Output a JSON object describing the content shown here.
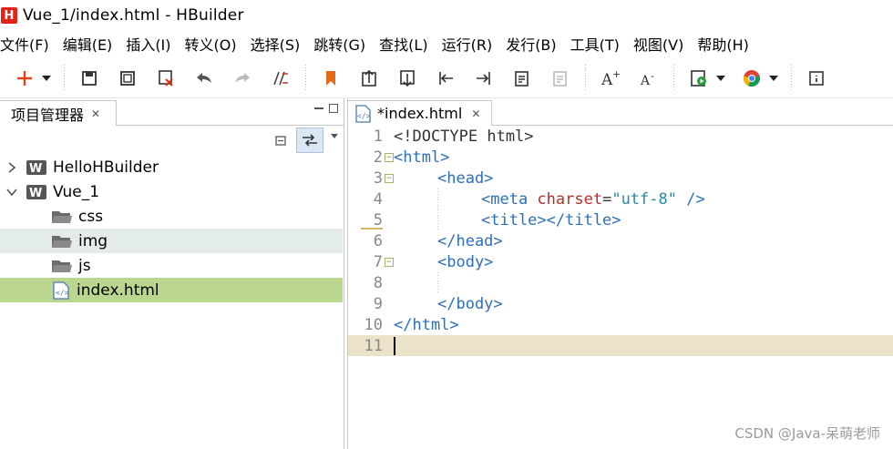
{
  "window": {
    "logo_letter": "H",
    "title": "Vue_1/index.html  -  HBuilder"
  },
  "menu": [
    "文件(F)",
    "编辑(E)",
    "插入(I)",
    "转义(O)",
    "选择(S)",
    "跳转(G)",
    "查找(L)",
    "运行(R)",
    "发行(B)",
    "工具(T)",
    "视图(V)",
    "帮助(H)"
  ],
  "toolbar_icons": [
    "new-icon",
    "save-icon",
    "save-all-icon",
    "close-save-icon",
    "undo-icon",
    "redo-icon",
    "format-icon",
    "bookmark-icon",
    "jump-start-icon",
    "jump-end-icon",
    "line-start-icon",
    "line-end-icon",
    "paste-icon",
    "paste-disabled-icon",
    "font-increase-icon",
    "font-decrease-icon",
    "run-icon",
    "chrome-icon",
    "help-icon"
  ],
  "project_panel": {
    "tab_label": "项目管理器",
    "tree": [
      {
        "label": "HelloHBuilder",
        "type": "project",
        "expanded": false
      },
      {
        "label": "Vue_1",
        "type": "project",
        "expanded": true
      },
      {
        "label": "css",
        "type": "folder"
      },
      {
        "label": "img",
        "type": "folder"
      },
      {
        "label": "js",
        "type": "folder"
      },
      {
        "label": "index.html",
        "type": "file"
      }
    ]
  },
  "editor": {
    "tab_label": "*index.html",
    "line_numbers": [
      "1",
      "2",
      "3",
      "4",
      "5",
      "6",
      "7",
      "8",
      "9",
      "10",
      "11"
    ],
    "code": {
      "l1": "<!DOCTYPE html>",
      "l2_tag": "<html>",
      "l3_tag": "<head>",
      "l4_open": "<meta ",
      "l4_attr": "charset",
      "l4_eq": "=",
      "l4_val": "\"utf-8\"",
      "l4_close": " />",
      "l5": "<title></title>",
      "l6": "</head>",
      "l7": "<body>",
      "l9": "</body>",
      "l10": "</html>"
    }
  },
  "watermark": "CSDN @Java-呆萌老师",
  "colors": {
    "selection": "#bbd68e",
    "hover": "#e4ece8",
    "current_line": "#ebe3c9",
    "tag": "#2d6fb8",
    "attr": "#b0302a",
    "string": "#2a8aa0",
    "logo": "#e2231a"
  }
}
